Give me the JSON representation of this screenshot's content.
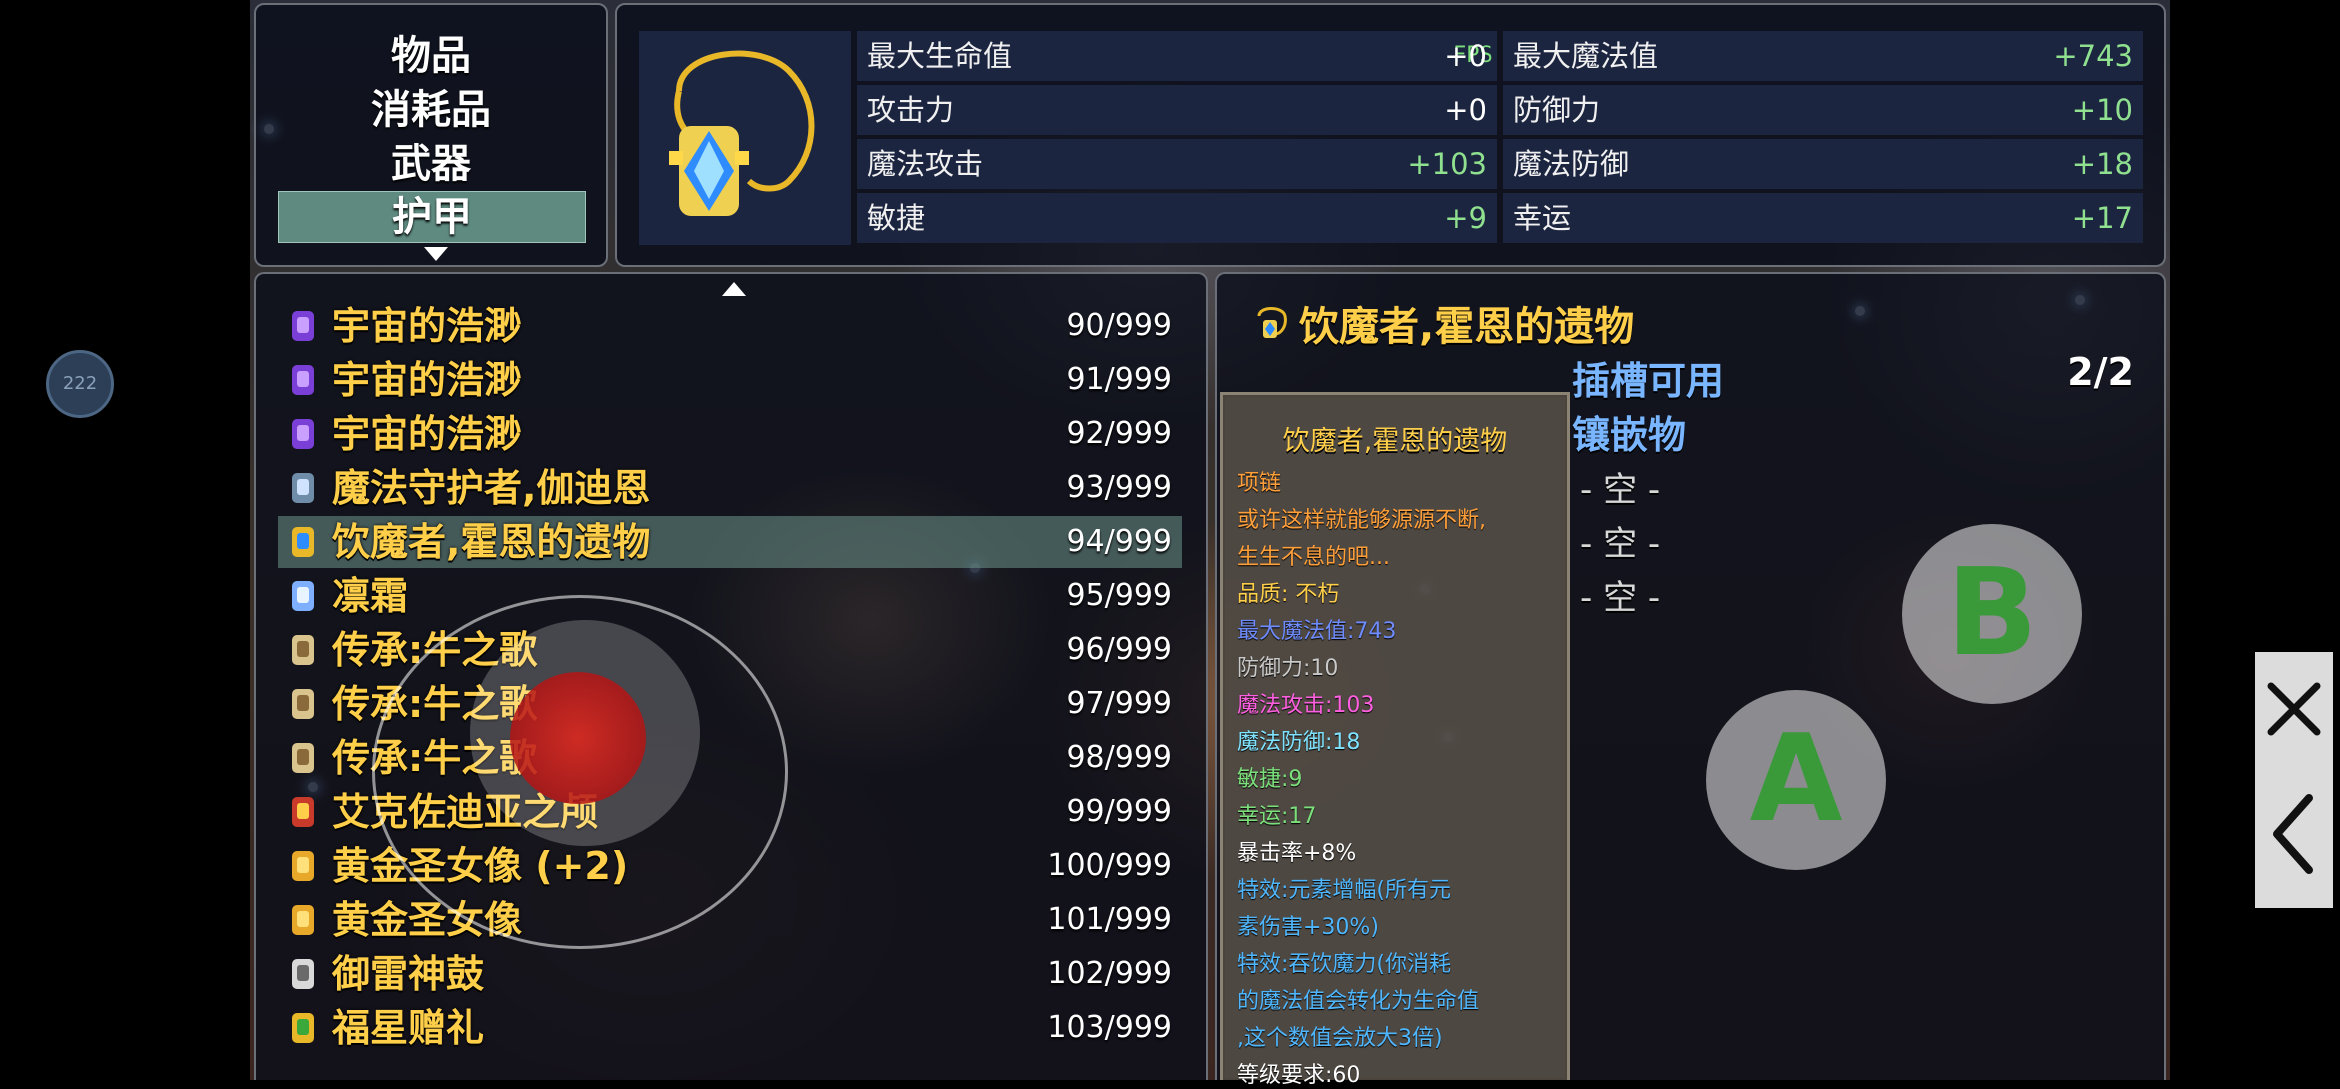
{
  "categories": [
    "物品",
    "消耗品",
    "武器",
    "护甲"
  ],
  "active_category": "护甲",
  "fps": "FPS 60",
  "stats": {
    "left": [
      {
        "label": "最大生命值",
        "value": "+0"
      },
      {
        "label": "攻击力",
        "value": "+0"
      },
      {
        "label": "魔法攻击",
        "value": "+103"
      },
      {
        "label": "敏捷",
        "value": "+9"
      }
    ],
    "right": [
      {
        "label": "最大魔法值",
        "value": "+743"
      },
      {
        "label": "防御力",
        "value": "+10"
      },
      {
        "label": "魔法防御",
        "value": "+18"
      },
      {
        "label": "幸运",
        "value": "+17"
      }
    ]
  },
  "items": [
    {
      "name": "宇宙的浩渺",
      "count": "90/999",
      "icon": "purple-gem-icon"
    },
    {
      "name": "宇宙的浩渺",
      "count": "91/999",
      "icon": "purple-gem-icon"
    },
    {
      "name": "宇宙的浩渺",
      "count": "92/999",
      "icon": "purple-gem-icon"
    },
    {
      "name": "魔法守护者,伽迪恩",
      "count": "93/999",
      "icon": "shield-icon"
    },
    {
      "name": "饮魔者,霍恩的遗物",
      "count": "94/999",
      "icon": "necklace-icon"
    },
    {
      "name": "凛霜",
      "count": "95/999",
      "icon": "frost-orb-icon"
    },
    {
      "name": "传承:牛之歌",
      "count": "96/999",
      "icon": "scroll-icon"
    },
    {
      "name": "传承:牛之歌",
      "count": "97/999",
      "icon": "scroll-icon"
    },
    {
      "name": "传承:牛之歌",
      "count": "98/999",
      "icon": "scroll-icon"
    },
    {
      "name": "艾克佐迪亚之颅",
      "count": "99/999",
      "icon": "skull-mask-icon"
    },
    {
      "name": "黄金圣女像 (+2)",
      "count": "100/999",
      "icon": "golden-statue-icon"
    },
    {
      "name": "黄金圣女像",
      "count": "101/999",
      "icon": "golden-statue-icon"
    },
    {
      "name": "御雷神鼓",
      "count": "102/999",
      "icon": "drums-icon"
    },
    {
      "name": "福星赠礼",
      "count": "103/999",
      "icon": "gift-necklace-icon"
    }
  ],
  "selected_index": 4,
  "detail": {
    "title": "饮魔者,霍恩的遗物",
    "slots_label": "插槽可用",
    "slots_count": "2/2",
    "inlay_label": "镶嵌物",
    "empty_slots": [
      "- 空 -",
      "- 空 -",
      "- 空 -"
    ]
  },
  "tooltip": {
    "title": "饮魔者,霍恩的遗物",
    "lines": [
      {
        "text": "项链",
        "color": "#ff9f3a"
      },
      {
        "text": "或许这样就能够源源不断,",
        "color": "#ff9f3a"
      },
      {
        "text": "生生不息的吧...",
        "color": "#ff9f3a"
      },
      {
        "text": "品质: 不朽",
        "color": "#ffcf4a"
      },
      {
        "text": "最大魔法值:743",
        "color": "#6f8cff"
      },
      {
        "text": "防御力:10",
        "color": "#c9c9c9"
      },
      {
        "text": "魔法攻击:103",
        "color": "#ff5fe0"
      },
      {
        "text": "魔法防御:18",
        "color": "#7fe3ff"
      },
      {
        "text": "敏捷:9",
        "color": "#7be07b"
      },
      {
        "text": "幸运:17",
        "color": "#7be07b"
      },
      {
        "text": "暴击率+8%",
        "color": "#ffffff"
      },
      {
        "text": "特效:元素增幅(所有元",
        "color": "#4fb7ff"
      },
      {
        "text": "素伤害+30%)",
        "color": "#4fb7ff"
      },
      {
        "text": "特效:吞饮魔力(你消耗",
        "color": "#4fb7ff"
      },
      {
        "text": "的魔法值会转化为生命值",
        "color": "#4fb7ff"
      },
      {
        "text": ",这个数值会放大3倍)",
        "color": "#4fb7ff"
      },
      {
        "text": "等级要求:60",
        "color": "#ffffff"
      }
    ]
  },
  "controls": {
    "a_label": "A",
    "b_label": "B",
    "fps_bubble": "222"
  }
}
